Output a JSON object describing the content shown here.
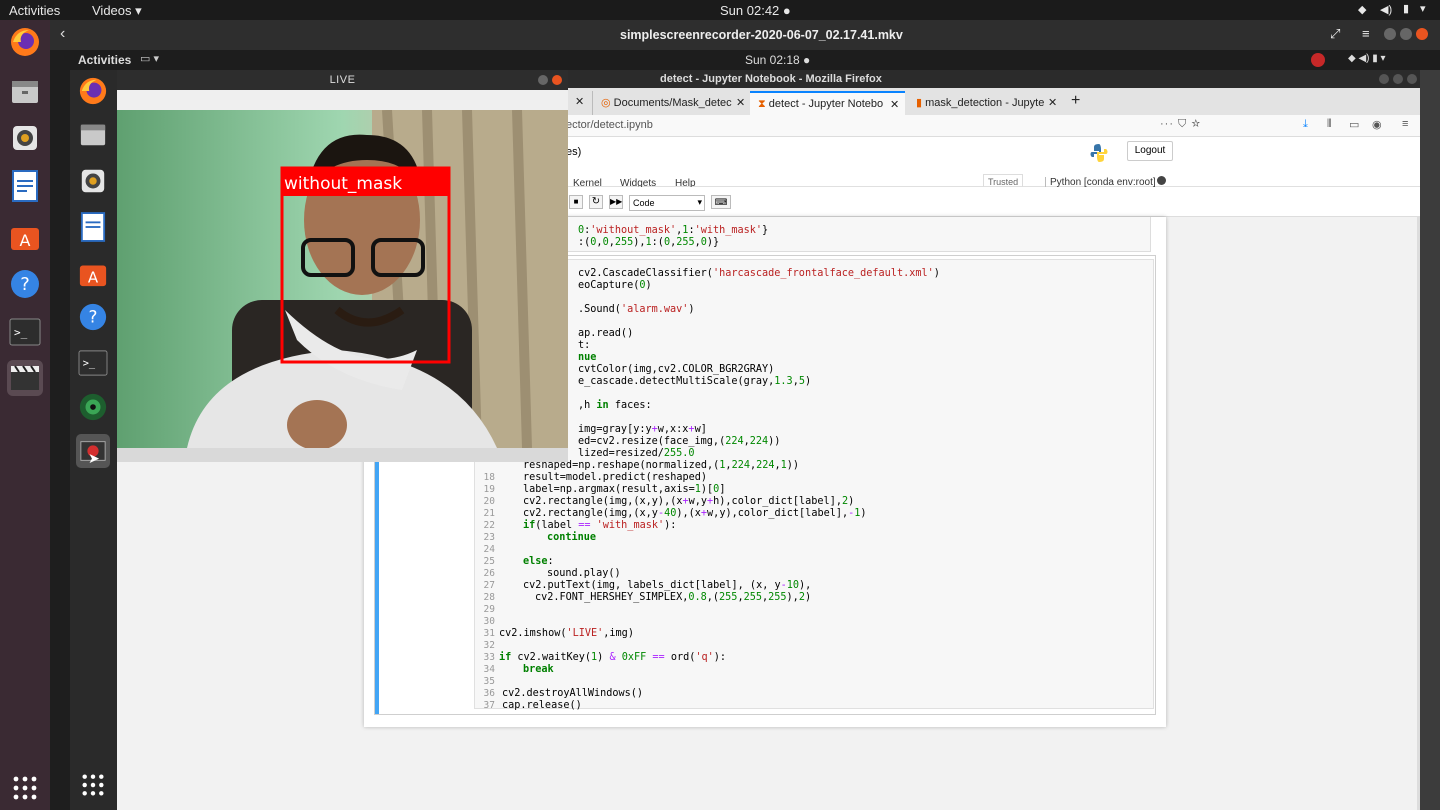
{
  "topbar": {
    "activities": "Activities",
    "app_menu": "Videos",
    "clock": "Sun 02:42"
  },
  "player": {
    "title": "simplescreenrecorder-2020-06-07_02.17.41.mkv"
  },
  "inner": {
    "activities": "Activities",
    "clock": "Sun 02:18"
  },
  "firefox": {
    "title": "detect - Jupyter Notebook - Mozilla Firefox",
    "tabs": [
      "Documents/Mask_detec",
      "detect - Jupyter Notebo",
      "mask_detection - Jupyte"
    ],
    "url": "ector/detect.ipynb"
  },
  "jupyter": {
    "header_partial": "es)",
    "logout": "Logout",
    "menu": [
      "Kernel",
      "Widgets",
      "Help"
    ],
    "trusted": "Trusted",
    "kernel": "Python [conda env:root] *",
    "cell_type": "Code"
  },
  "live": {
    "title": "LIVE",
    "label": "without_mask"
  },
  "colors": {
    "accent": "#42a5f5",
    "box_red": "#ff0000",
    "record": "#e53935"
  }
}
